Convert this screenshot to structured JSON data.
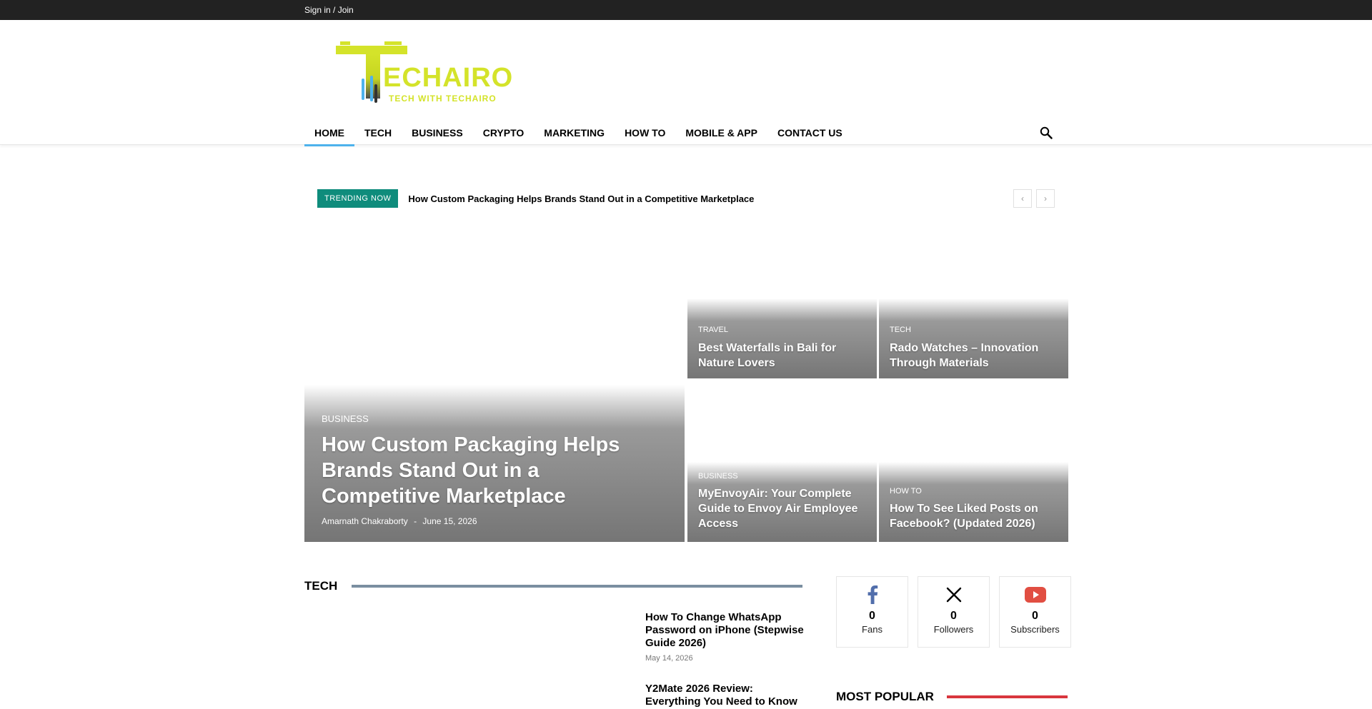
{
  "topbar": {
    "signin_label": "Sign in / Join"
  },
  "logo": {
    "name": "TECHAIRO",
    "tagline": "TECH WITH TECHAIRO",
    "primary_color": "#d4e32a",
    "accent_color": "#4db2ec"
  },
  "nav": {
    "items": [
      {
        "label": "HOME"
      },
      {
        "label": "TECH"
      },
      {
        "label": "BUSINESS"
      },
      {
        "label": "CRYPTO"
      },
      {
        "label": "MARKETING"
      },
      {
        "label": "HOW TO"
      },
      {
        "label": "MOBILE & APP"
      },
      {
        "label": "CONTACT US"
      }
    ],
    "active_color": "#4db2ec",
    "search_icon": "search-icon"
  },
  "trending": {
    "badge": "TRENDING NOW",
    "title": "How Custom Packaging Helps Brands Stand Out in a Competitive Marketplace",
    "badge_color": "#0f8c7c",
    "prev_symbol": "‹",
    "next_symbol": "›"
  },
  "featured": {
    "big": {
      "category": "BUSINESS",
      "title": "How Custom Packaging Helps Brands Stand Out in a Competitive Marketplace",
      "author": "Amarnath Chakraborty",
      "separator": "-",
      "date": "June 15, 2026"
    },
    "tiles": [
      {
        "category": "TRAVEL",
        "title": "Best Waterfalls in Bali for Nature Lovers"
      },
      {
        "category": "TECH",
        "title": "Rado Watches – Innovation Through Materials"
      },
      {
        "category": "BUSINESS",
        "title": "MyEnvoyAir: Your Complete Guide to Envoy Air Employee Access"
      },
      {
        "category": "HOW TO",
        "title": "How To See Liked Posts on Facebook? (Updated 2026)"
      }
    ]
  },
  "tech_section": {
    "heading": "TECH",
    "line_color": "#7a8ea0",
    "posts": [
      {
        "title": "How To Change WhatsApp Password on iPhone (Stepwise Guide 2026)",
        "date": "May 14, 2026"
      },
      {
        "title": "Y2Mate 2026 Review: Everything You Need to Know",
        "date": ""
      }
    ]
  },
  "social": [
    {
      "icon": "facebook-icon",
      "count": "0",
      "label": "Fans",
      "color": "#516eab"
    },
    {
      "icon": "x-icon",
      "count": "0",
      "label": "Followers",
      "color": "#000000"
    },
    {
      "icon": "youtube-icon",
      "count": "0",
      "label": "Subscribers",
      "color": "#e14e42"
    }
  ],
  "popular": {
    "heading": "MOST POPULAR",
    "line_color": "#d9363e"
  }
}
